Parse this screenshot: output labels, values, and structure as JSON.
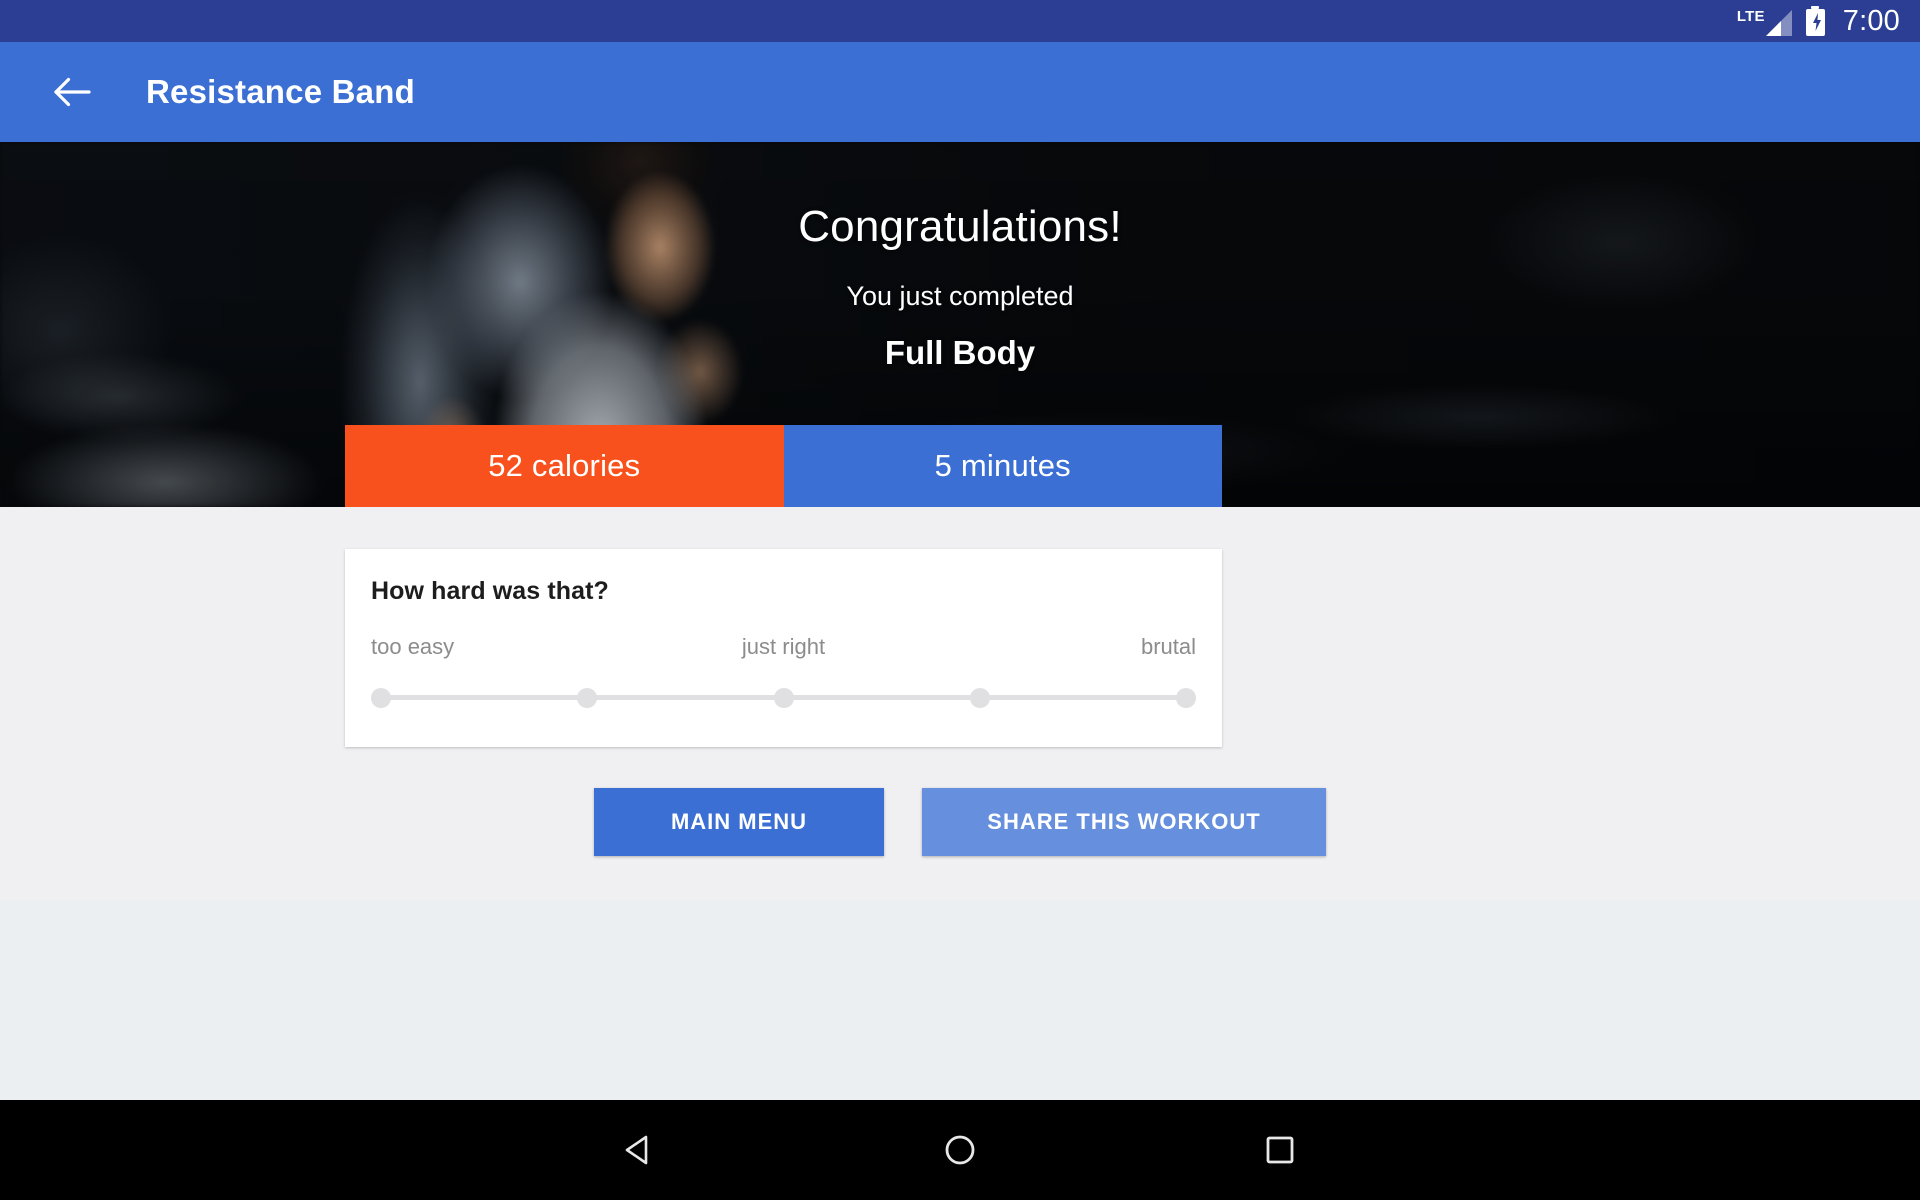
{
  "status_bar": {
    "network_label": "LTE",
    "signal_icon": "signal-bars-icon",
    "battery_icon": "battery-charging-icon",
    "time": "7:00",
    "background_color": "#2c3e94"
  },
  "app_bar": {
    "back_icon": "back-arrow-icon",
    "title": "Resistance Band",
    "background_color": "#3b6fd4"
  },
  "hero": {
    "congrats": "Congratulations!",
    "subtitle": "You just completed",
    "workout_name": "Full Body"
  },
  "stats": [
    {
      "label": "52 calories",
      "name": "calories",
      "value": 52,
      "unit": "calories",
      "color": "#f9511d"
    },
    {
      "label": "5 minutes",
      "name": "duration",
      "value": 5,
      "unit": "minutes",
      "color": "#3b6fd4"
    }
  ],
  "difficulty_card": {
    "title": "How hard was that?",
    "scale_labels": {
      "left": "too easy",
      "middle": "just right",
      "right": "brutal"
    },
    "steps": 5,
    "selected": null,
    "track_color": "#e0e0e2"
  },
  "actions": {
    "main_menu": "MAIN MENU",
    "share_workout": "SHARE THIS WORKOUT",
    "main_menu_color": "#3b6fd4",
    "share_color": "#6690de"
  },
  "nav_bar": {
    "back_icon": "nav-back-triangle-icon",
    "home_icon": "nav-home-circle-icon",
    "recents_icon": "nav-recents-square-icon",
    "background_color": "#000000"
  }
}
